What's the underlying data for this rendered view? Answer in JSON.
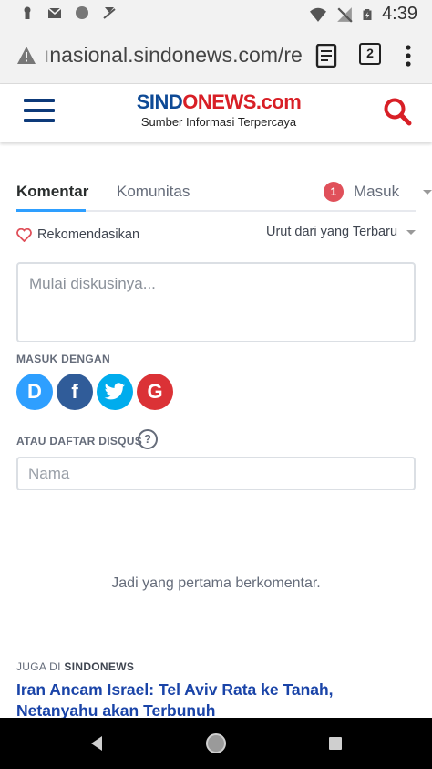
{
  "status_bar": {
    "time": "4:39"
  },
  "browser": {
    "url_faded": "ı",
    "url": "nasional.sindonews.com/re",
    "tab_count": "2"
  },
  "site": {
    "logo_part1": "SIND",
    "logo_part2": "NEWS.com",
    "logo_o": "O",
    "tagline": "Sumber Informasi Terpercaya"
  },
  "disqus": {
    "tab_comments": "Komentar",
    "tab_community": "Komunitas",
    "notification_count": "1",
    "login_label": "Masuk",
    "recommend_label": "Rekomendasikan",
    "sort_label": "Urut dari yang Terbaru",
    "comment_placeholder": "Mulai diskusinya...",
    "login_with_label": "MASUK DENGAN",
    "social": [
      {
        "name": "disqus",
        "glyph": "D"
      },
      {
        "name": "facebook",
        "glyph": "f"
      },
      {
        "name": "twitter",
        "glyph": "t"
      },
      {
        "name": "google",
        "glyph": "G"
      }
    ],
    "register_label": "ATAU DAFTAR DISQUS",
    "help_glyph": "?",
    "name_placeholder": "Nama",
    "empty_message": "Jadi yang pertama berkomentar."
  },
  "related": {
    "label_prefix": "JUGA DI ",
    "label_site": "SINDONEWS",
    "headline": "Iran Ancam Israel: Tel Aviv Rata ke Tanah, Netanyahu akan Terbunuh"
  },
  "colors": {
    "brand_blue": "#0e4a96",
    "brand_red": "#d81f26",
    "accent_blue": "#2e9fff",
    "badge_red": "#e0505a",
    "link_blue": "#1a44a8"
  }
}
